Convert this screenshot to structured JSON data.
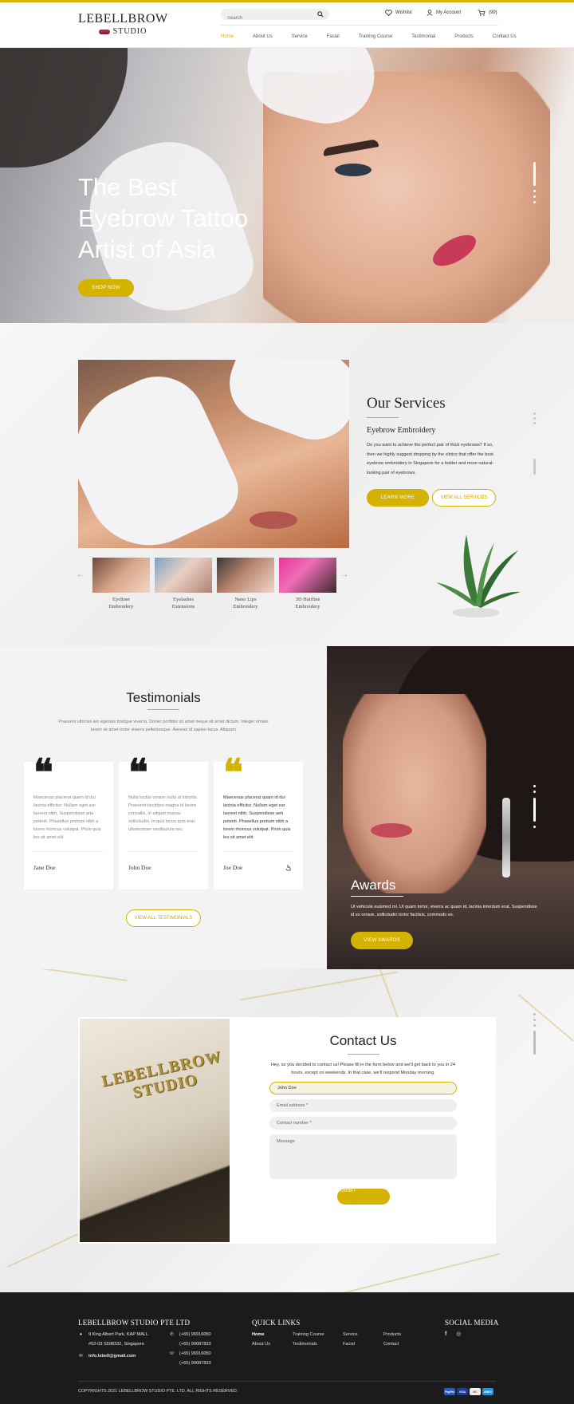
{
  "brand": {
    "line1": "LEBELLBROW",
    "line2": "STUDIO"
  },
  "search": {
    "placeholder": "Search"
  },
  "account": {
    "wishlist": "Wishlist",
    "my_account": "My Account",
    "cart": "(99)"
  },
  "nav": {
    "items": [
      "Home",
      "About Us",
      "Service",
      "Facial",
      "Training Course",
      "Testimonial",
      "Products",
      "Contact Us"
    ],
    "active": "Home"
  },
  "hero": {
    "title_line1": "The Best",
    "title_line2": "Eyebrow Tattoo",
    "title_line3": "Artist of Asia",
    "cta": "SHOP NOW"
  },
  "services": {
    "title": "Our Services",
    "subtitle": "Eyebrow Embroidery",
    "body": "Do you want to achieve the perfect pair of thick eyebrows? If so, then we highly suggest dropping by the clinics that offer the best eyebrow embroidery in Singapore for a bolder and more natural-looking pair of eyebrows.",
    "learn_more": "LEARN MORE",
    "view_all": "VIEW ALL SERVICES",
    "thumbs": [
      {
        "label1": "Eyeliner",
        "label2": "Embroidery"
      },
      {
        "label1": "Eyelashes",
        "label2": "Extensions"
      },
      {
        "label1": "Nano Lips",
        "label2": "Embroidery"
      },
      {
        "label1": "3D Hairline",
        "label2": "Embroidery"
      }
    ],
    "prev": "←",
    "next": "→"
  },
  "testimonials": {
    "title": "Testimonials",
    "intro": "Praesent ultricies leo egestas tristique viverra. Donec porttitor sit amet neque sit amet dictum. Integer ornare lorem sit amet tortor viverra pellentesque. Aenean id sapien lacus. Aliquam",
    "cards": [
      {
        "quote_mark": "❝",
        "text": "Maecenas placerat quam id dui lacinia efficitur. Nullam eget are laoreet nibh. Suspendisse aria potenti. Phasellus pretium nibh a lorem rhoncus volutpat. Proin quis leo sit amet elit",
        "name": "Jane Doe"
      },
      {
        "quote_mark": "❝",
        "text": "Nulla luctus ornare nulla ut lobortis. Praesent tincidunt magna id lorem convallis, in aliquet massa sollicitudin. In quis lacus quis erat ullamcorper vestibulum nec",
        "name": "John Doe"
      },
      {
        "quote_mark": "❝",
        "text": "Maecenas placerat quam id dui lacinia efficitur. Nullam eget ear laoreet nibh. Suspendisse aeti potenti. Phasellus pretium nibh a lorem rhoncus volutpat. Proin quis leo sit amet elit",
        "name": "Joe Doe"
      }
    ],
    "view_all": "VIEW ALL TESTIMONIALS"
  },
  "awards": {
    "title": "Awards",
    "body": "Ut vehicula euismod mi. Ut quam tortor, viverra ac quam id, lacinia interdum erat. Suspendisse id ex ornare, sollicitudin tortor facilisis, commodo ex.",
    "cta": "VIEW AWARDS"
  },
  "contact": {
    "title": "Contact Us",
    "intro": "Hey, so you decided to contact us! Please fill in the form below and we'll get back to you in 24 hours, except on weekends. In that case, we'll respond Monday morning.",
    "name_value": "John Doe",
    "email_placeholder": "Email address *",
    "phone_placeholder": "Contact number *",
    "message_placeholder": "Message",
    "submit": "SUBMIT",
    "image_sign_line1": "LEBELLBROW",
    "image_sign_line2": "STUDIO"
  },
  "footer": {
    "company": "LEBELLBROW STUDIO PTE LTD",
    "address1": "9 King Albert Park, KAP MALL",
    "address2": "#02-03 S598332, Singapore",
    "email": "info.lebell@gmail.com",
    "phones": [
      "(+65) 96916050",
      "(+65) 90087833",
      "(+65) 96916050",
      "(+65) 90087833"
    ],
    "quick_links_title": "QUICK LINKS",
    "quick_links": [
      "Home",
      "About Us",
      "Training Course",
      "Testimonials",
      "Service",
      "Facial",
      "Products",
      "Contact"
    ],
    "social_title": "SOCIAL MEDIA",
    "social": [
      "f",
      "◎"
    ],
    "copyright": "COPYRIGHTS 2021 LEBELLBROW STUDIO PTE. LTD. ALL RIGHTS RESERVED.",
    "payments": [
      "PayPal",
      "VISA",
      "MC",
      "AMEX"
    ]
  },
  "colors": {
    "accent": "#d4b200",
    "footer_bg": "#1c1b1c"
  }
}
